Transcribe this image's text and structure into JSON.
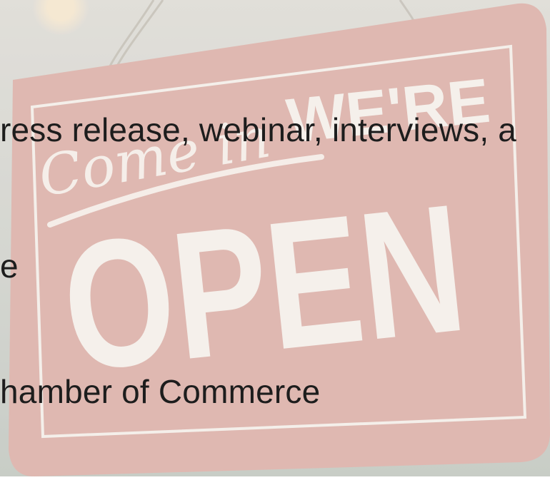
{
  "sign": {
    "script": "Come in",
    "top": "WE'RE",
    "big": "OPEN"
  },
  "text_lines": [
    "ress release, webinar, interviews, a",
    "e",
    "hamber of Commerce"
  ]
}
